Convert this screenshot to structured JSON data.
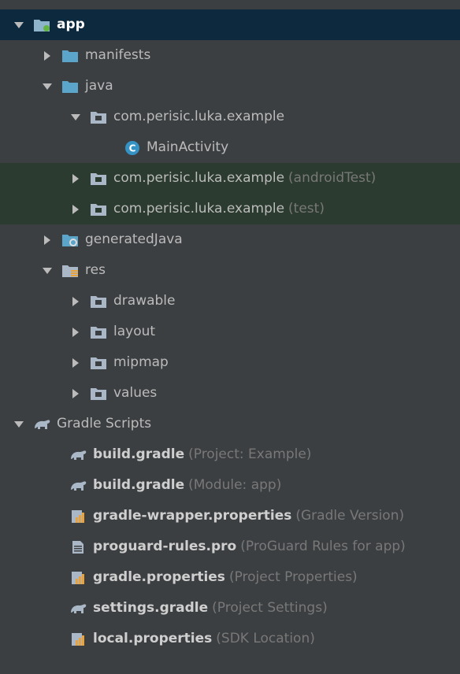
{
  "tree": {
    "app": "app",
    "manifests": "manifests",
    "java": "java",
    "pkg_main": "com.perisic.luka.example",
    "main_activity": "MainActivity",
    "pkg_android_test": "com.perisic.luka.example",
    "pkg_android_test_hint": "(androidTest)",
    "pkg_test": "com.perisic.luka.example",
    "pkg_test_hint": "(test)",
    "generated_java": "generatedJava",
    "res": "res",
    "drawable": "drawable",
    "layout": "layout",
    "mipmap": "mipmap",
    "values": "values",
    "gradle_scripts": "Gradle Scripts",
    "build_gradle_project": "build.gradle",
    "build_gradle_project_hint": "(Project: Example)",
    "build_gradle_module": "build.gradle",
    "build_gradle_module_hint": "(Module: app)",
    "gradle_wrapper": "gradle-wrapper.properties",
    "gradle_wrapper_hint": "(Gradle Version)",
    "proguard": "proguard-rules.pro",
    "proguard_hint": "(ProGuard Rules for app)",
    "gradle_properties": "gradle.properties",
    "gradle_properties_hint": "(Project Properties)",
    "settings_gradle": "settings.gradle",
    "settings_gradle_hint": "(Project Settings)",
    "local_properties": "local.properties",
    "local_properties_hint": "(SDK Location)"
  },
  "colors": {
    "background": "#3c3f41",
    "selection": "#0d293e",
    "test_highlight": "#2c3b2f",
    "folder_blue": "#5aa5c9",
    "class_icon": "#3592c4"
  }
}
